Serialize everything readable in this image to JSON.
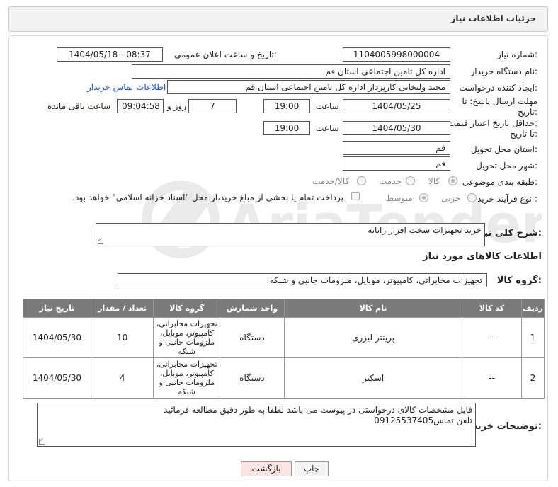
{
  "header": {
    "title": "جزئیات اطلاعات نیاز"
  },
  "form": {
    "need_number_label": "شماره نیاز:",
    "need_number": "1104005998000004",
    "announce_label": "تاریخ و ساعت اعلان عمومی:",
    "announce_value": "1404/05/18 - 08:37",
    "buyer_org_label": "نام دستگاه خریدار:",
    "buyer_org": "اداره کل تامین اجتماعی استان قم",
    "requester_label": "ایجاد کننده درخواست:",
    "requester": "مجید ولیخانی کارپرداز اداره کل تامین اجتماعی استان قم",
    "contact_link": "اطلاعات تماس خریدار",
    "deadline_label_1": "مهلت ارسال پاسخ: تا",
    "deadline_label_2": "تاریخ:",
    "deadline_date": "1404/05/25",
    "time_label": "ساعت",
    "deadline_time": "19:00",
    "days_value": "7",
    "days_label": "روز و",
    "remaining_time": "09:04:58",
    "remaining_label": "ساعت باقی مانده",
    "min_validity_label_1": "حداقل تاریخ اعتبار قیمت:",
    "min_validity_label_2": "تا تاریخ:",
    "validity_date": "1404/05/30",
    "validity_time": "19:00",
    "province_label": "استان محل تحویل:",
    "province": "قم",
    "city_label": "شهر محل تحویل:",
    "city": "قم",
    "category_label": "طبقه بندی موضوعی:",
    "category_options": [
      "کالا",
      "خدمت",
      "کالا/خدمت"
    ],
    "process_label": "نوع فرآیند خرید :",
    "process_options": [
      "جزیی",
      "متوسط"
    ],
    "payment_note": "پرداخت تمام یا بخشی از مبلغ خرید،از محل \"اسناد خزانه اسلامی\" خواهد بود.",
    "description_label": "شرح کلی نیاز:",
    "description": "خرید تجهیزات سخت افزار رایانه",
    "goods_info_title": "اطلاعات کالاهای مورد نیاز",
    "goods_group_label": "گروه کالا:",
    "goods_group": "تجهیزات مخابراتی، کامپیوتر، موبایل، ملزومات جانبی و شبکه"
  },
  "table": {
    "headers": [
      "ردیف",
      "کد کالا",
      "نام کالا",
      "واحد شمارش",
      "گروه کالا",
      "تعداد / مقدار",
      "تاریخ نیاز"
    ],
    "rows": [
      {
        "idx": "1",
        "code": "--",
        "name": "پرینتر لیزری",
        "unit": "دستگاه",
        "group": "تجهیزات مخابراتی، کامپیوتر، موبایل، ملزومات جانبی و شبکه",
        "qty": "10",
        "date": "1404/05/30"
      },
      {
        "idx": "2",
        "code": "--",
        "name": "اسکنر",
        "unit": "دستگاه",
        "group": "تجهیزات مخابراتی، کامپیوتر، موبایل، ملزومات جانبی و شبکه",
        "qty": "4",
        "date": "1404/05/30"
      }
    ]
  },
  "buyer_notes": {
    "label": "توضیحات خریدار:",
    "line1": "فایل مشخصات کالای درخواستی در پیوست می باشد لطفا به طور دقیق مطالعه فرمائید",
    "line2": "تلفن تماس09125537405"
  },
  "buttons": {
    "print": "چاپ",
    "back": "بازگشت"
  },
  "watermark": {
    "brand": "AriaTender.net"
  },
  "colors": {
    "table_header": "#7a7a7a",
    "link": "#1a55c9",
    "back_button": "#fde4e4"
  }
}
